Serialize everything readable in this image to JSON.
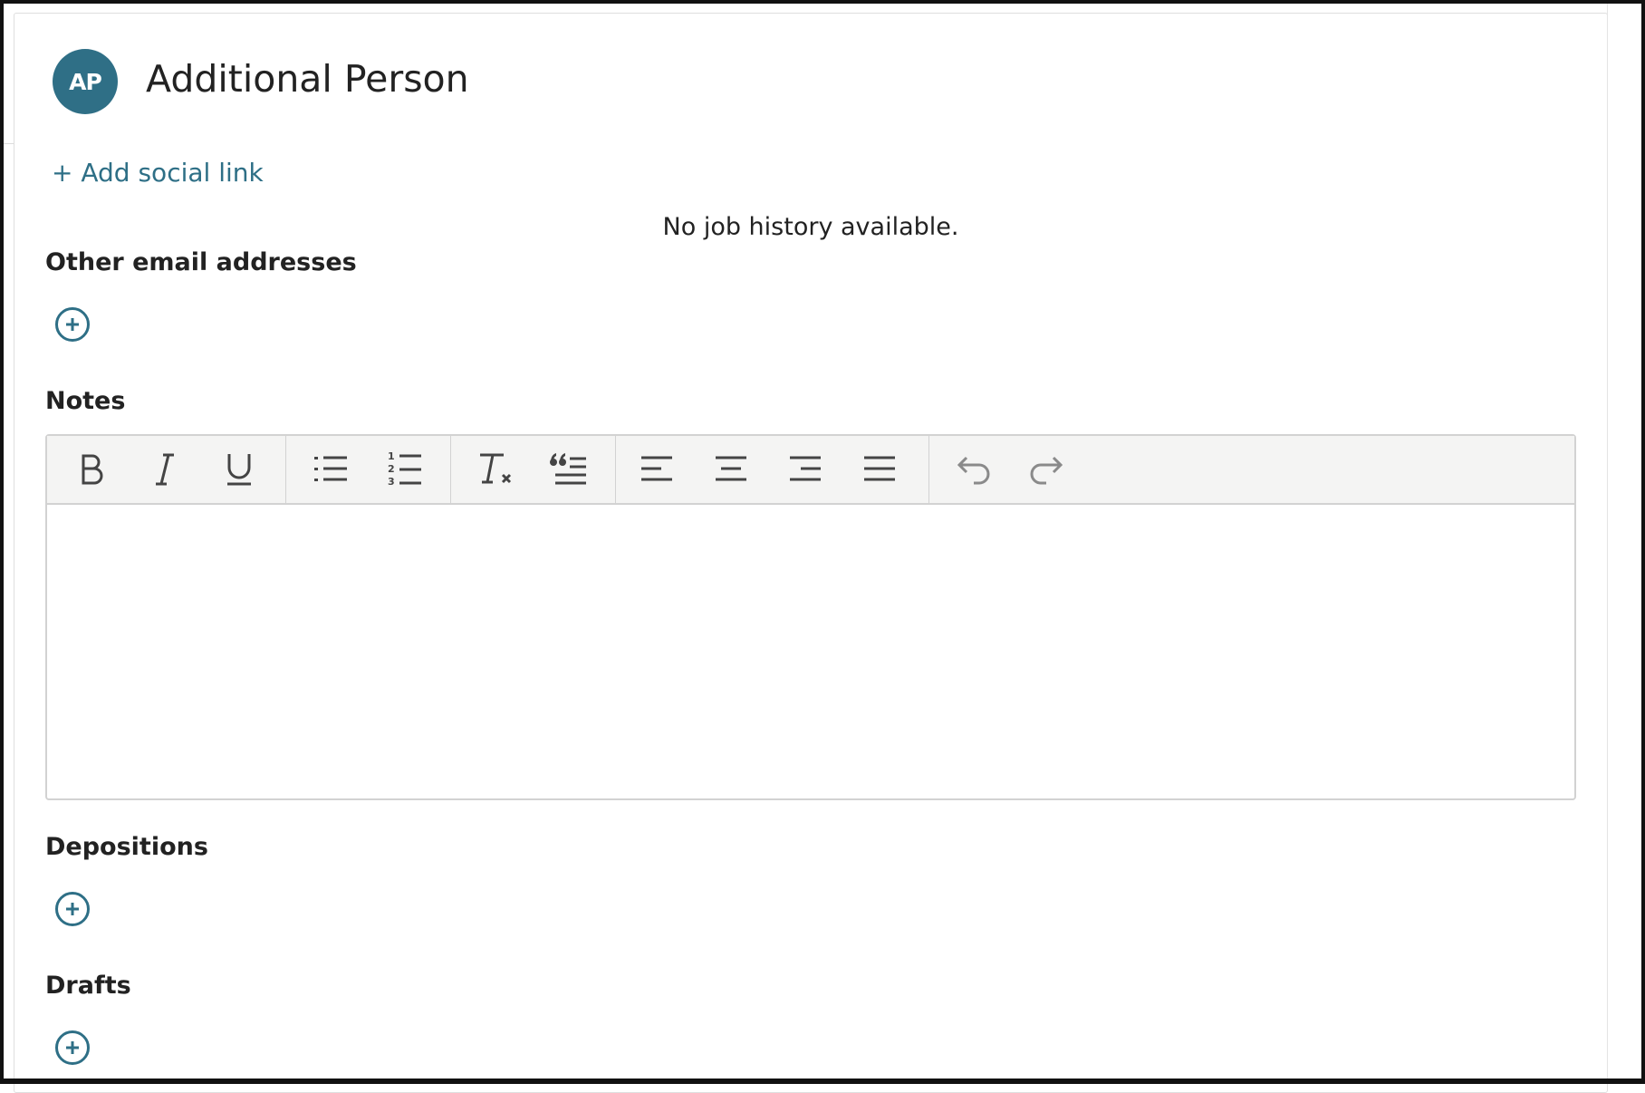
{
  "person": {
    "initials": "AP",
    "name": "Additional Person",
    "avatar_color": "#2f6f86"
  },
  "links": {
    "add_social_link": "+ Add social link"
  },
  "job_history": {
    "empty_text": "No job history available."
  },
  "sections": {
    "other_emails": {
      "label": "Other email addresses",
      "add_icon": "plus-circle-icon"
    },
    "notes": {
      "label": "Notes",
      "content": "",
      "toolbar": [
        "bold",
        "italic",
        "underline",
        "bulleted-list",
        "numbered-list",
        "clear-formatting",
        "blockquote",
        "align-left",
        "align-center",
        "align-right",
        "align-justify",
        "undo",
        "redo"
      ]
    },
    "depositions": {
      "label": "Depositions",
      "add_icon": "plus-circle-icon"
    },
    "drafts": {
      "label": "Drafts",
      "add_icon": "plus-circle-icon"
    }
  },
  "colors": {
    "accent": "#2e6f86",
    "text": "#222222",
    "toolbar_bg": "#f4f4f3",
    "border": "#d2d2d2"
  }
}
